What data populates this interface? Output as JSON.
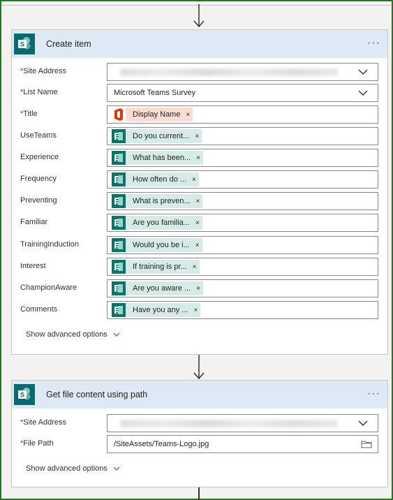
{
  "card1": {
    "title": "Create item",
    "more_label": "···",
    "fields": {
      "site_address": {
        "label": "Site Address",
        "required": true
      },
      "list_name": {
        "label": "List Name",
        "required": true,
        "value": "Microsoft Teams Survey"
      },
      "title": {
        "label": "Title",
        "required": true,
        "token": "Display Name",
        "remove": "×"
      },
      "use_teams": {
        "label": "UseTeams",
        "token": "Do you current...",
        "remove": "×"
      },
      "experience": {
        "label": "Experience",
        "token": "What has been...",
        "remove": "×"
      },
      "frequency": {
        "label": "Frequency",
        "token": "How often do ...",
        "remove": "×"
      },
      "preventing": {
        "label": "Preventing",
        "token": "What is preven...",
        "remove": "×"
      },
      "familiar": {
        "label": "Familiar",
        "token": "Are you familia...",
        "remove": "×"
      },
      "training_induction": {
        "label": "TrainingInduction",
        "token": "Would you be i...",
        "remove": "×"
      },
      "interest": {
        "label": "Interest",
        "token": "If training is pr...",
        "remove": "×"
      },
      "champion_aware": {
        "label": "ChampionAware",
        "token": "Are you aware ...",
        "remove": "×"
      },
      "comments": {
        "label": "Comments",
        "token": "Have you any ...",
        "remove": "×"
      }
    },
    "advanced": "Show advanced options"
  },
  "card2": {
    "title": "Get file content using path",
    "more_label": "···",
    "fields": {
      "site_address": {
        "label": "Site Address",
        "required": true
      },
      "file_path": {
        "label": "File Path",
        "required": true,
        "value": "/SiteAssets/Teams-Logo.jpg"
      }
    },
    "advanced": "Show advanced options"
  },
  "required_mark": "*",
  "colors": {
    "header_bg": "#dfe9f3",
    "sharepoint": "#036c70",
    "forms_token": "#d6ebe7",
    "forms_icon": "#077568",
    "office_token": "#fbdcd3",
    "office_icon": "#d83b01",
    "accent": "#0f6cbd",
    "required": "#a4262c",
    "frame": "#1e7b1e"
  },
  "icons": {
    "connector": "sharepoint-icon",
    "forms_token": "forms-icon",
    "office_token": "office-icon",
    "dropdown": "chevron-down-icon",
    "file_picker": "folder-icon",
    "flow_arrow": "arrow-down-icon"
  }
}
